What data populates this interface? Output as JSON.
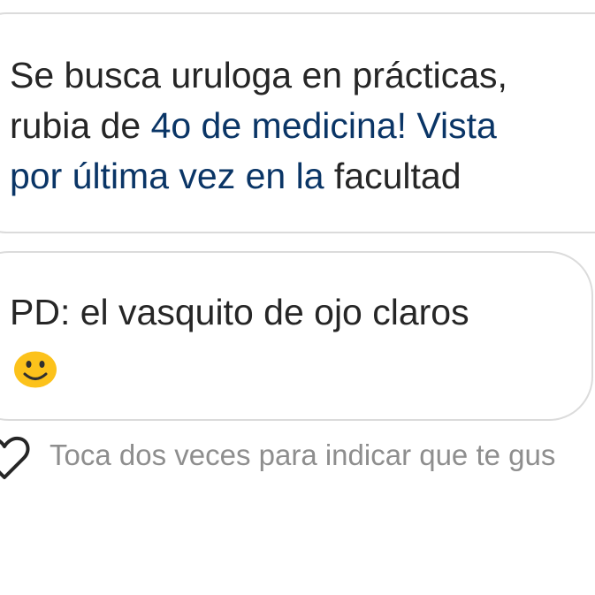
{
  "messages": [
    {
      "segments": [
        "Se busca uruloga en prácticas,",
        "rubia de ",
        "4o de medicina! Vista",
        "por última vez en la",
        " facultad"
      ]
    },
    {
      "text": "PD: el vasquito de ojo claros",
      "emoji": "slightly-smiling-face-icon"
    }
  ],
  "footer": {
    "like_icon": "heart-outline-icon",
    "hint": "Toca dos veces para indicar que te gus"
  },
  "colors": {
    "text": "#262626",
    "link": "#0a3566",
    "hint": "#8e8e8e",
    "bubble_border": "#dbdbdb",
    "emoji_fill": "#fcc21b"
  }
}
